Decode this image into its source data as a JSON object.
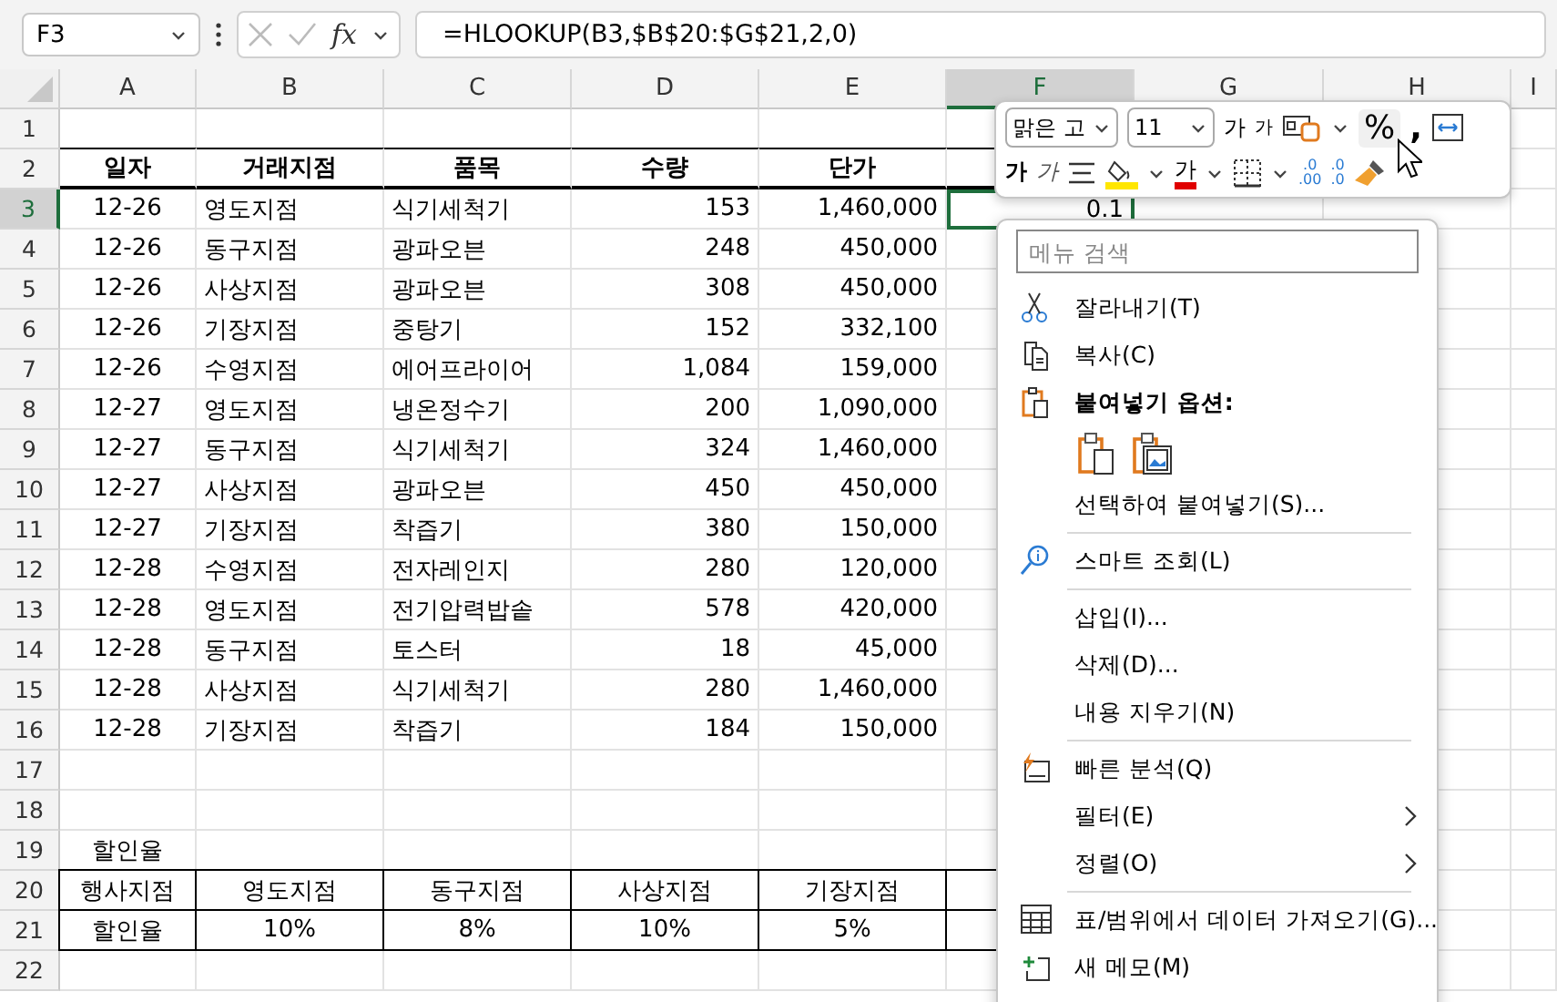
{
  "formula_bar": {
    "name_box": "F3",
    "fx_label": "fx",
    "formula": "=HLOOKUP(B3,$B$20:$G$21,2,0)"
  },
  "column_headers": [
    {
      "label": "A",
      "selected": false
    },
    {
      "label": "B",
      "selected": false
    },
    {
      "label": "C",
      "selected": false
    },
    {
      "label": "D",
      "selected": false
    },
    {
      "label": "E",
      "selected": false
    },
    {
      "label": "F",
      "selected": true
    },
    {
      "label": "G",
      "selected": false
    },
    {
      "label": "H",
      "selected": false
    },
    {
      "label": "I",
      "selected": false
    }
  ],
  "row_headers": [
    {
      "label": "1",
      "selected": false
    },
    {
      "label": "2",
      "selected": false
    },
    {
      "label": "3",
      "selected": true
    },
    {
      "label": "4",
      "selected": false
    },
    {
      "label": "5",
      "selected": false
    },
    {
      "label": "6",
      "selected": false
    },
    {
      "label": "7",
      "selected": false
    },
    {
      "label": "8",
      "selected": false
    },
    {
      "label": "9",
      "selected": false
    },
    {
      "label": "10",
      "selected": false
    },
    {
      "label": "11",
      "selected": false
    },
    {
      "label": "12",
      "selected": false
    },
    {
      "label": "13",
      "selected": false
    },
    {
      "label": "14",
      "selected": false
    },
    {
      "label": "15",
      "selected": false
    },
    {
      "label": "16",
      "selected": false
    },
    {
      "label": "17",
      "selected": false
    },
    {
      "label": "18",
      "selected": false
    },
    {
      "label": "19",
      "selected": false
    },
    {
      "label": "20",
      "selected": false
    },
    {
      "label": "21",
      "selected": false
    },
    {
      "label": "22",
      "selected": false
    }
  ],
  "sales_table": {
    "columns": [
      "일자",
      "거래지점",
      "품목",
      "수량",
      "단가"
    ],
    "rows": [
      [
        "12-26",
        "영도지점",
        "식기세척기",
        "153",
        "1,460,000"
      ],
      [
        "12-26",
        "동구지점",
        "광파오븐",
        "248",
        "450,000"
      ],
      [
        "12-26",
        "사상지점",
        "광파오븐",
        "308",
        "450,000"
      ],
      [
        "12-26",
        "기장지점",
        "중탕기",
        "152",
        "332,100"
      ],
      [
        "12-26",
        "수영지점",
        "에어프라이어",
        "1,084",
        "159,000"
      ],
      [
        "12-27",
        "영도지점",
        "냉온정수기",
        "200",
        "1,090,000"
      ],
      [
        "12-27",
        "동구지점",
        "식기세척기",
        "324",
        "1,460,000"
      ],
      [
        "12-27",
        "사상지점",
        "광파오븐",
        "450",
        "450,000"
      ],
      [
        "12-27",
        "기장지점",
        "착즙기",
        "380",
        "150,000"
      ],
      [
        "12-28",
        "수영지점",
        "전자레인지",
        "280",
        "120,000"
      ],
      [
        "12-28",
        "영도지점",
        "전기압력밥솥",
        "578",
        "420,000"
      ],
      [
        "12-28",
        "동구지점",
        "토스터",
        "18",
        "45,000"
      ],
      [
        "12-28",
        "사상지점",
        "식기세척기",
        "280",
        "1,460,000"
      ],
      [
        "12-28",
        "기장지점",
        "착즙기",
        "184",
        "150,000"
      ]
    ]
  },
  "active_cell": {
    "text": "0.1"
  },
  "discount_title": "할인율",
  "discount_table": {
    "rows": [
      [
        "행사지점",
        "영도지점",
        "동구지점",
        "사상지점",
        "기장지점"
      ],
      [
        "할인율",
        "10%",
        "8%",
        "10%",
        "5%"
      ]
    ]
  },
  "mini_toolbar": {
    "font_name": "맑은 고",
    "font_size": "11",
    "grow_font": "가",
    "shrink_font": "가",
    "percent": "%",
    "comma": ",",
    "bold": "가",
    "italic": "가",
    "font_color": "가",
    "decrease_decimal": {
      "upper": ".0",
      "lower": ".00"
    },
    "increase_decimal": {
      "upper": ".0",
      "lower": ".0"
    }
  },
  "context_menu": {
    "search": {
      "placeholder": "메뉴 검색"
    },
    "items": [
      {
        "kind": "cut",
        "label": "잘라내기(T)",
        "has_submenu": false
      },
      {
        "kind": "copy",
        "label": "복사(C)",
        "has_submenu": false
      },
      {
        "kind": "paste-heading",
        "label": "붙여넣기 옵션:",
        "has_submenu": false
      },
      {
        "kind": "paste-options"
      },
      {
        "kind": "plain",
        "label": "선택하여 붙여넣기(S)...",
        "has_submenu": false
      },
      {
        "kind": "separator"
      },
      {
        "kind": "lookup",
        "label": "스마트 조회(L)",
        "has_submenu": false
      },
      {
        "kind": "separator"
      },
      {
        "kind": "plain",
        "label": "삽입(I)...",
        "has_submenu": false
      },
      {
        "kind": "plain",
        "label": "삭제(D)...",
        "has_submenu": false
      },
      {
        "kind": "plain",
        "label": "내용 지우기(N)",
        "has_submenu": false
      },
      {
        "kind": "separator"
      },
      {
        "kind": "analysis",
        "label": "빠른 분석(Q)",
        "has_submenu": false
      },
      {
        "kind": "plain",
        "label": "필터(E)",
        "has_submenu": true
      },
      {
        "kind": "plain",
        "label": "정렬(O)",
        "has_submenu": true
      },
      {
        "kind": "separator"
      },
      {
        "kind": "table",
        "label": "표/범위에서 데이터 가져오기(G)...",
        "has_submenu": false
      },
      {
        "kind": "note",
        "label": "새 메모(M)",
        "has_submenu": false
      }
    ]
  }
}
